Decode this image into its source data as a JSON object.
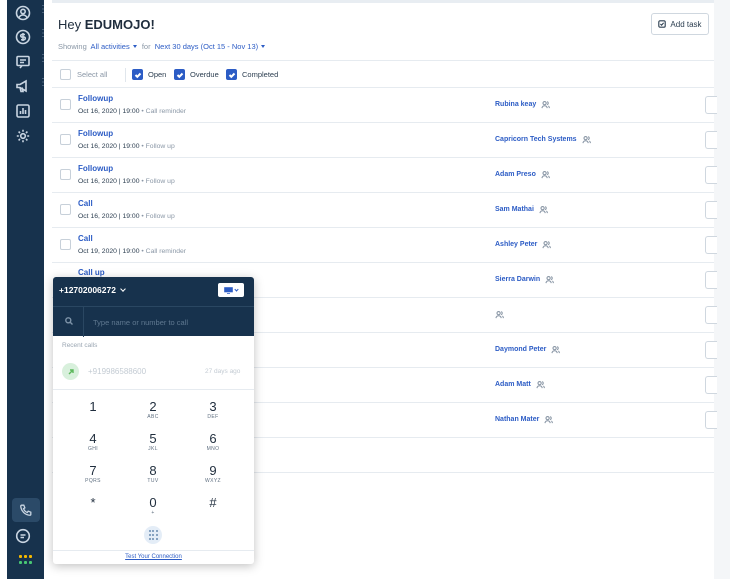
{
  "greeting": {
    "prefix": "Hey ",
    "name": "EDUMOJO!"
  },
  "toolbar": {
    "add_task_label": "Add task"
  },
  "filters": {
    "showing_label": "Showing",
    "activities": "All activities",
    "for_label": "for",
    "range": "Next 30 days (Oct 15 - Nov 13)"
  },
  "bulk": {
    "select_all": "Select all",
    "open": "Open",
    "overdue": "Overdue",
    "completed": "Completed"
  },
  "tasks": [
    {
      "title": "Followup",
      "datetime": "Oct 16, 2020 | 19:00",
      "type": "Call reminder",
      "contact": "Rubina keay"
    },
    {
      "title": "Followup",
      "datetime": "Oct 16, 2020 | 19:00",
      "type": "Follow up",
      "contact": "Capricorn Tech Systems"
    },
    {
      "title": "Followup",
      "datetime": "Oct 16, 2020 | 19:00",
      "type": "Follow up",
      "contact": "Adam Preso"
    },
    {
      "title": "Call",
      "datetime": "Oct 16, 2020 | 19:00",
      "type": "Follow up",
      "contact": "Sam Mathai"
    },
    {
      "title": "Call",
      "datetime": "Oct 19, 2020 | 19:00",
      "type": "Call reminder",
      "contact": "Ashley Peter"
    },
    {
      "title": "Call up",
      "datetime": "",
      "type": "",
      "contact": "Sierra Darwin"
    },
    {
      "title": "",
      "datetime": "",
      "type": "",
      "contact": ""
    },
    {
      "title": "",
      "datetime": "",
      "type": "",
      "contact": "Daymond Peter"
    },
    {
      "title": "",
      "datetime": "",
      "type": "",
      "contact": "Adam Matt"
    },
    {
      "title": "",
      "datetime": "",
      "type": "",
      "contact": "Nathan Mater"
    }
  ],
  "dialer": {
    "number": "+12702006272",
    "search_placeholder": "Type name or number to call",
    "recent_label": "Recent calls",
    "recent": {
      "number": "+919986588600",
      "time": "27 days ago"
    },
    "keys": [
      {
        "digit": "1",
        "letters": ""
      },
      {
        "digit": "2",
        "letters": "ABC"
      },
      {
        "digit": "3",
        "letters": "DEF"
      },
      {
        "digit": "4",
        "letters": "GHI"
      },
      {
        "digit": "5",
        "letters": "JKL"
      },
      {
        "digit": "6",
        "letters": "MNO"
      },
      {
        "digit": "7",
        "letters": "PQRS"
      },
      {
        "digit": "8",
        "letters": "TUV"
      },
      {
        "digit": "9",
        "letters": "WXYZ"
      },
      {
        "digit": "*",
        "letters": ""
      },
      {
        "digit": "0",
        "letters": "+"
      },
      {
        "digit": "#",
        "letters": ""
      }
    ],
    "test_connection": "Test Your Connection"
  },
  "icons": {
    "nav": [
      "contacts-icon",
      "deals-icon",
      "conversations-icon",
      "campaigns-icon",
      "reports-icon",
      "settings-icon"
    ],
    "nav_bottom": [
      "phone-icon",
      "chat-icon",
      "apps-icon"
    ]
  },
  "colors": {
    "nav_bg": "#17324d",
    "link": "#2c5cc5",
    "accent_green": "#5cb85c"
  }
}
